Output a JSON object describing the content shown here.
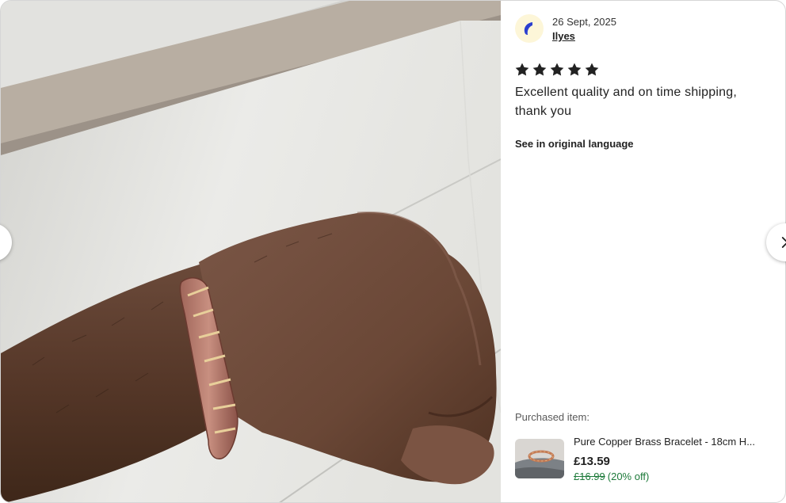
{
  "review": {
    "date": "26 Sept, 2025",
    "reviewer_name": "Ilyes",
    "rating": 5,
    "rating_max": 5,
    "text": "Excellent quality and on time shipping, thank you",
    "translate_link": "See in original language"
  },
  "purchased": {
    "label": "Purchased item:",
    "title": "Pure Copper Brass Bracelet - 18cm H...",
    "price": "£13.59",
    "original_price": "£16.99",
    "discount": "(20% off)"
  },
  "photo": {
    "subject": "wrist-with-copper-brass-bracelet"
  },
  "icons": {
    "prev": "chevron-left-icon",
    "next": "chevron-right-icon",
    "star": "star-icon",
    "avatar": "avatar-icon"
  },
  "colors": {
    "star": "#222222",
    "avatar_bg": "#fdf6d8",
    "avatar_mark": "#2b3fcf",
    "sale_green": "#1d7a3a"
  }
}
